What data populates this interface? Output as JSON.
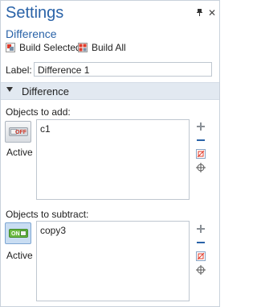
{
  "window": {
    "title": "Settings",
    "subtitle": "Difference"
  },
  "toolbar": {
    "build_selected": "Build Selected",
    "build_all": "Build All"
  },
  "label_field": {
    "label": "Label:",
    "value": "Difference 1"
  },
  "section": {
    "title": "Difference"
  },
  "add_group": {
    "label": "Objects to add:",
    "toggle_state": "OFF",
    "active_label": "Active",
    "items": [
      "c1"
    ]
  },
  "subtract_group": {
    "label": "Objects to subtract:",
    "toggle_state": "ON",
    "active_label": "Active",
    "items": [
      "copy3"
    ]
  },
  "colors": {
    "accent": "#2a63a8",
    "section_bg": "#e2e9f1",
    "off_red": "#d23a2a",
    "on_green": "#6cba43"
  },
  "icons": [
    "pin-icon",
    "close-icon",
    "build-selected-icon",
    "build-all-icon",
    "collapse-caret-icon",
    "add-icon",
    "remove-icon",
    "clear-selection-icon",
    "zoom-to-selection-icon"
  ]
}
